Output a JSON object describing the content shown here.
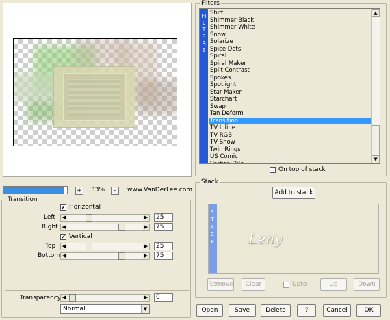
{
  "preview": {
    "zoom": "33%",
    "zoom_plus": "+",
    "zoom_minus": "-",
    "website": "www.VanDerLee.com",
    "progress": 0.95
  },
  "transition": {
    "group_title": "Transition",
    "horizontal_label": "Horizontal",
    "horizontal_checked": true,
    "vertical_label": "Vertical",
    "vertical_checked": true,
    "left_label": "Left",
    "left_value": "25",
    "right_label": "Right",
    "right_value": "75",
    "top_label": "Top",
    "top_value": "25",
    "bottom_label": "Bottom",
    "bottom_value": "75",
    "transparency_label": "Transparency",
    "transparency_value": "0",
    "blend_mode": "Normal"
  },
  "filters": {
    "group_title": "Filters",
    "vertical_label": "FILTERS",
    "items": [
      "Shift",
      "Shimmer Black",
      "Shimmer White",
      "Snow",
      "Solarize",
      "Spice Dots",
      "Spiral",
      "Spiral Maker",
      "Split Contrast",
      "Spokes",
      "Spotlight",
      "Star Maker",
      "Starchart",
      "Swap",
      "Tan Deform",
      "Transition",
      "TV Inline",
      "TV RGB",
      "TV Snow",
      "Twin Rings",
      "US Comic",
      "Vertical Tile"
    ],
    "selected_index": 15,
    "on_top_label": "On top of stack",
    "on_top_checked": false
  },
  "stack": {
    "group_title": "Stack",
    "vertical_label": "STACK",
    "add_label": "Add to stack",
    "watermark": "Leny",
    "remove_label": "Remove",
    "clear_label": "Clear",
    "upto_label": "Upto",
    "up_label": "Up",
    "down_label": "Down"
  },
  "footer": {
    "open_label": "Open",
    "save_label": "Save",
    "delete_label": "Delete",
    "help_label": "?",
    "cancel_label": "Cancel",
    "ok_label": "OK"
  },
  "glyphs": {
    "left_arrow": "◀",
    "right_arrow": "▶",
    "up_arrow": "▲",
    "down_arrow": "▼",
    "check": "✔"
  },
  "colors": {
    "selection": "#3399ff",
    "filter_strip": "#2458d6",
    "stack_strip": "#7b9de5",
    "progress": "#3b8fe0"
  }
}
